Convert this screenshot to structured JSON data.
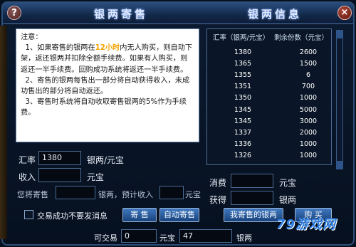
{
  "titles": {
    "sell": "银两寄售",
    "info": "银两信息"
  },
  "buttons": {
    "help": "?",
    "close": "×"
  },
  "notice": {
    "heading": "注意：",
    "p1_prefix": "1、如果寄售的银两在",
    "p1_highlight": "12小时",
    "p1_suffix": "内无人购买，则自动下架，返还银两并扣除全额手续费。如果有人购买，则返还一半手续费。回购成功系统将返还一半手续费。",
    "p2": "2、寄售的银两每售出一部分将自动获得收入，未成功售出的部分将自动返还。",
    "p3": "3、寄售时系统将自动收取寄售银两的5%作为手续费。"
  },
  "sell_form": {
    "rate_label": "汇率",
    "rate_value": "1380",
    "rate_unit": "银两/元宝",
    "income_label": "收入",
    "income_value": "",
    "income_unit": "元宝",
    "consign_label": "您将寄售",
    "consign_value": "",
    "consign_unit": "银两，预计收入",
    "expected_value": "",
    "expected_unit": "元宝",
    "no_msg_label": "交易成功不要发消息",
    "sell_button": "寄 售",
    "auto_sell_button": "自动寄售"
  },
  "rate_table": {
    "columns": [
      "汇率（银两/元宝）",
      "剩余份数（元宝）"
    ],
    "rows": [
      [
        "1380",
        "2600"
      ],
      [
        "1365",
        "1500"
      ],
      [
        "1355",
        "6"
      ],
      [
        "1351",
        "700"
      ],
      [
        "1350",
        "1000"
      ],
      [
        "1345",
        "5000"
      ],
      [
        "1345",
        "3000"
      ],
      [
        "1337",
        "2000"
      ],
      [
        "1336",
        "1000"
      ],
      [
        "1326",
        "1000"
      ]
    ]
  },
  "buy_form": {
    "spend_label": "消费",
    "spend_value": "",
    "spend_unit": "元宝",
    "gain_label": "获得",
    "gain_value": "",
    "gain_unit": "银两",
    "my_sold_button": "我寄售的银两",
    "buy_button": "购 买"
  },
  "tradable": {
    "label": "可交易",
    "yuanbao_value": "0",
    "yuanbao_unit": "元宝",
    "silver_value": "47",
    "silver_unit": "银两"
  },
  "watermark": "79游戏网"
}
